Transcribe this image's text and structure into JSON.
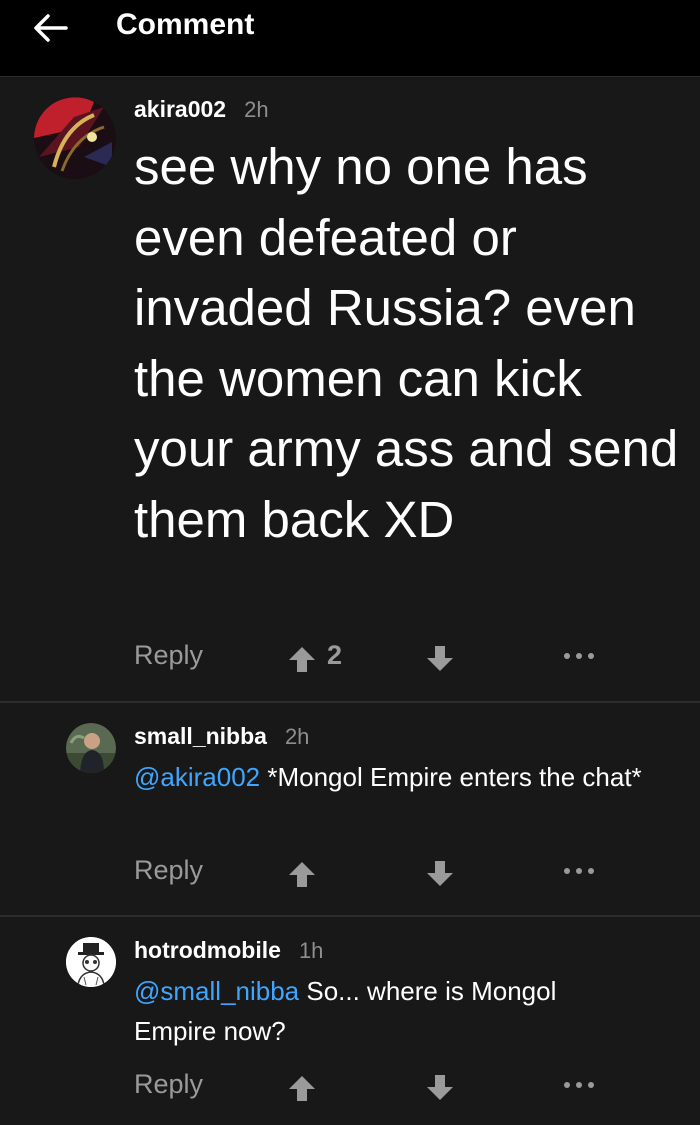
{
  "header": {
    "title": "Comment",
    "back_icon": "arrow-left-icon"
  },
  "comments": [
    {
      "username": "akira002",
      "time": "2h",
      "mention": "",
      "text": "see why no one has even defeated or invaded Russia? even the women can kick your army ass and send them back XD",
      "reply_label": "Reply",
      "votes": "2"
    },
    {
      "username": "small_nibba",
      "time": "2h",
      "mention": "@akira002",
      "text": " *Mongol Empire enters the chat*",
      "reply_label": "Reply",
      "votes": ""
    },
    {
      "username": "hotrodmobile",
      "time": "1h",
      "mention": "@small_nibba",
      "text": " So... where is Mongol Empire now?",
      "reply_label": "Reply",
      "votes": ""
    }
  ],
  "colors": {
    "background": "#181818",
    "header_background": "#000000",
    "mention": "#3ea6ff",
    "muted": "#9a9a9a"
  }
}
